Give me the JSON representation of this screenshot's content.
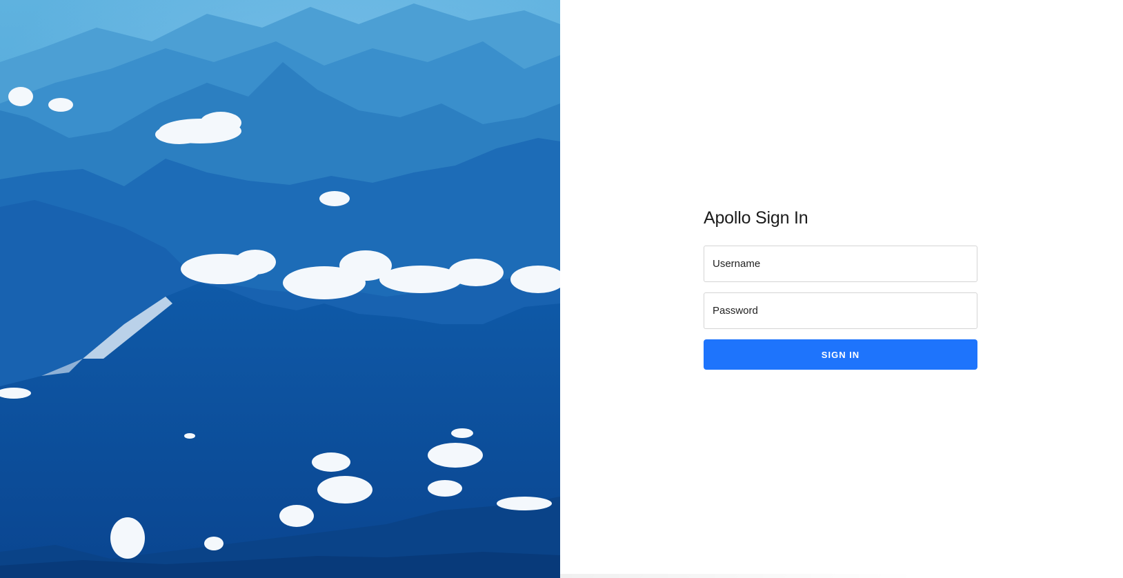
{
  "image": {
    "description_icon": "mountain-landscape-image",
    "colors": {
      "sky": "#4aa3d6",
      "far_mountains": "#2f86c8",
      "mid_mountains": "#1a6bb8",
      "near_mountains": "#0b4e9e",
      "clouds": "#f4f8fc"
    }
  },
  "signin": {
    "title": "Apollo Sign In",
    "username_placeholder": "Username",
    "username_value": "",
    "password_placeholder": "Password",
    "password_value": "",
    "submit_label": "SIGN IN",
    "accent_color": "#1e74fc"
  }
}
